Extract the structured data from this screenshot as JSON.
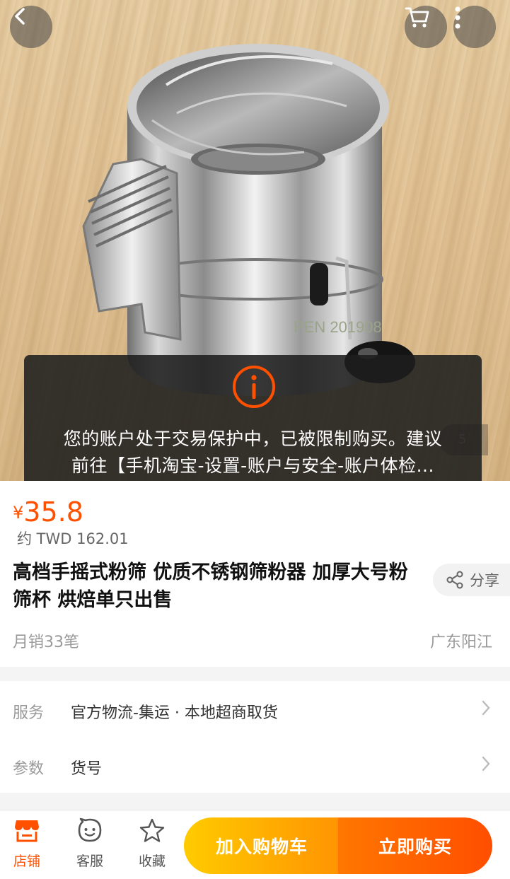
{
  "product_image": {
    "watermark": "PEN 201908"
  },
  "header": {
    "back_icon": "chevron-left-icon",
    "cart_icon": "cart-icon",
    "more_icon": "more-vertical-icon"
  },
  "toast": {
    "icon": "info-icon",
    "line1": "您的账户处于交易保护中，已被限制购买。建议",
    "line2": "前往【手机淘宝-设置-账户与安全-账户体检..."
  },
  "image_indicator": "5",
  "price": {
    "currency": "¥",
    "value": "35.8",
    "converted": "约 TWD 162.01"
  },
  "product": {
    "title": "高档手摇式粉筛 优质不锈钢筛粉器 加厚大号粉筛杯 烘焙单只出售",
    "share_label": "分享",
    "monthly_sales": "月销33笔",
    "location": "广东阳江"
  },
  "details": [
    {
      "key": "服务",
      "value": "官方物流-集运 · 本地超商取货"
    },
    {
      "key": "参数",
      "value": "货号"
    }
  ],
  "bottom_bar": {
    "shop_label": "店铺",
    "service_label": "客服",
    "favorite_label": "收藏",
    "add_to_cart": "加入购物车",
    "buy_now": "立即购买"
  },
  "colors": {
    "accent": "#ff5000",
    "cart_button": "#ffb000",
    "buy_button": "#ff5a00"
  }
}
